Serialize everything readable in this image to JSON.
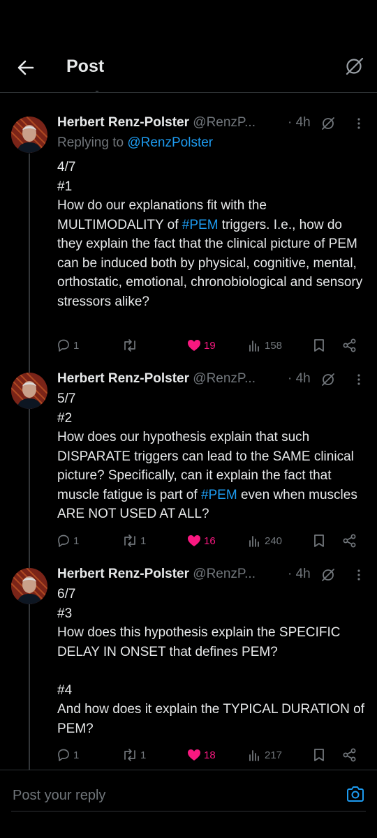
{
  "header": {
    "title": "Post",
    "back_icon": "arrow-left-icon",
    "grok_icon": "grok-icon"
  },
  "tweets": [
    {
      "name": "Herbert Renz-Polster",
      "handle": "@RenzP...",
      "dot": "·",
      "time": "4h",
      "replying_label": "Replying to",
      "replying_handle": "@RenzPolster",
      "lines": {
        "l1": "4/7",
        "l2": "#1",
        "l3a": "How do our explanations fit with the MULTIMODALITY of ",
        "l3tag": "#PEM",
        "l3b": " triggers. I.e., how do they explain the fact that the clinical picture of  PEM can be induced both by physical, cognitive, mental, orthostatic, emotional, chronobiological and sensory stressors alike?"
      },
      "stats": {
        "replies": "1",
        "reposts": "",
        "likes": "19",
        "views": "158"
      }
    },
    {
      "name": "Herbert Renz-Polster",
      "handle": "@RenzP...",
      "dot": "·",
      "time": "4h",
      "lines": {
        "l1": "5/7",
        "l2": "#2",
        "l3a": "How does our hypothesis explain that such DISPARATE triggers can lead to the SAME clinical picture? Specifically, can it explain the fact that muscle fatigue is part of ",
        "l3tag": "#PEM",
        "l3b": " even when muscles ARE NOT USED AT ALL?"
      },
      "stats": {
        "replies": "1",
        "reposts": "1",
        "likes": "16",
        "views": "240"
      }
    },
    {
      "name": "Herbert Renz-Polster",
      "handle": "@RenzP...",
      "dot": "·",
      "time": "4h",
      "lines": {
        "l1": "6/7",
        "l2": "#3",
        "l3": "How does this hypothesis explain the SPECIFIC DELAY IN ONSET that defines PEM?",
        "l4": "#4",
        "l5": "And how does it explain the TYPICAL DURATION of PEM?"
      },
      "stats": {
        "replies": "1",
        "reposts": "1",
        "likes": "18",
        "views": "217"
      }
    }
  ],
  "reply_bar": {
    "placeholder": "Post your reply",
    "camera_icon": "camera-icon"
  },
  "colors": {
    "background": "#000000",
    "text": "#e7e9ea",
    "muted": "#71767b",
    "link": "#1d9bf0",
    "like": "#f91880",
    "divider": "#2f3336"
  }
}
